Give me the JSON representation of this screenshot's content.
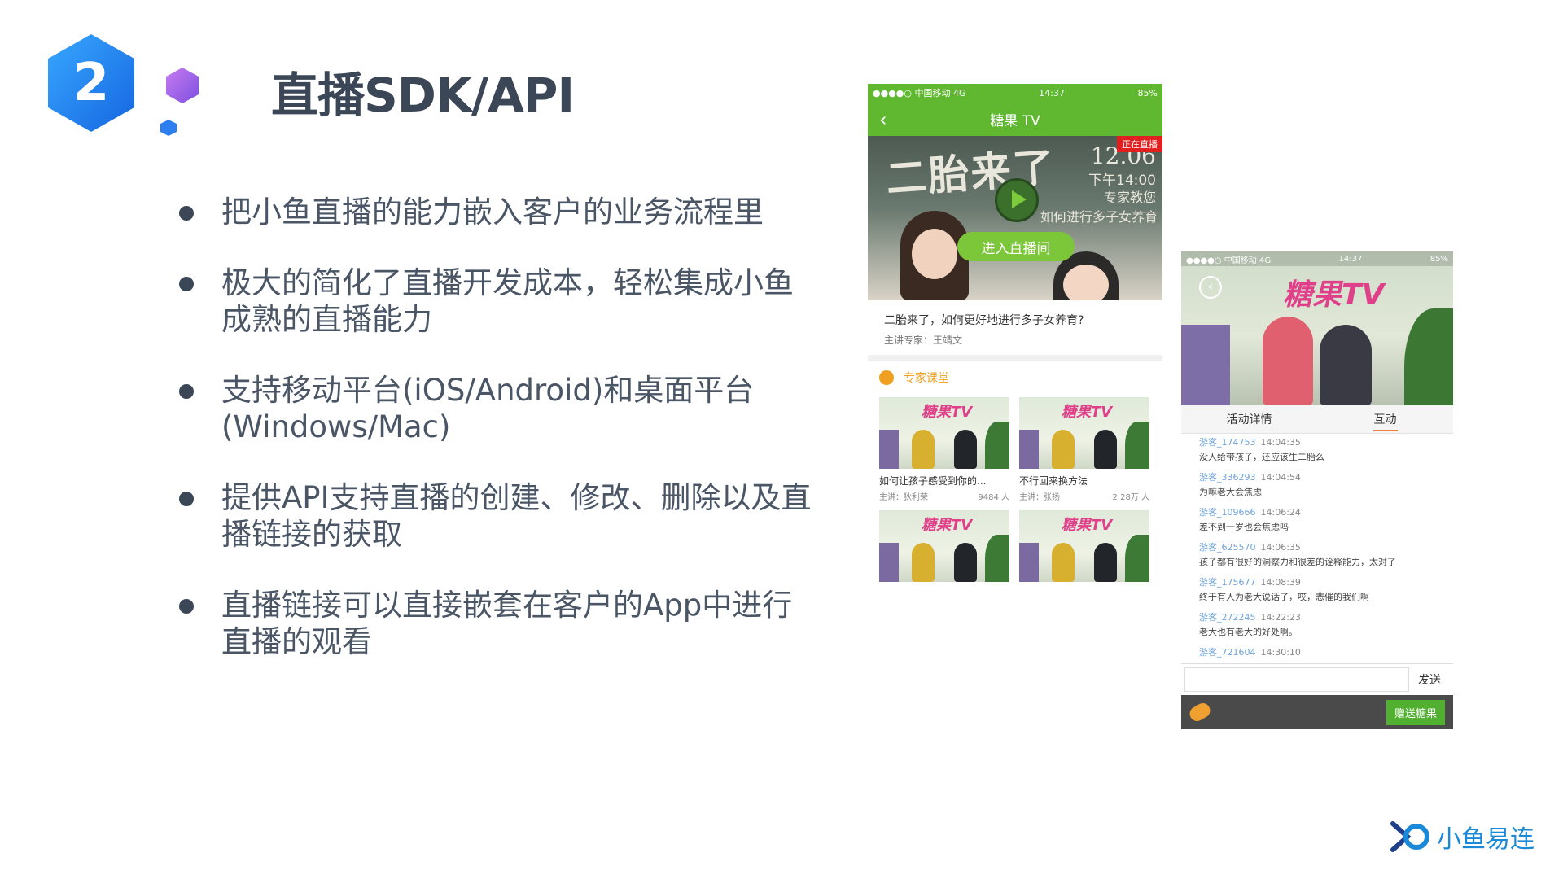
{
  "slide": {
    "number": "2",
    "title": "直播SDK/API",
    "bullets": [
      "把小鱼直播的能力嵌入客户的业务流程里",
      "极大的简化了直播开发成本，轻松集成小鱼成熟的直播能力",
      "支持移动平台(iOS/Android)和桌面平台(Windows/Mac)",
      "提供API支持直播的创建、修改、删除以及直播链接的获取",
      "直播链接可以直接嵌套在客户的App中进行直播的观看"
    ]
  },
  "phone1": {
    "status": {
      "carrier": "●●●●○ 中国移动 4G",
      "time": "14:37",
      "battery": "85%"
    },
    "nav_title": "糖果 TV",
    "hero": {
      "live_badge": "正在直播",
      "headline": "二胎来了",
      "date": "12.06",
      "time": "下午14:00",
      "line1": "专家教您",
      "line2": "如何进行多子女养育",
      "enter_label": "进入直播间"
    },
    "event_title": "二胎来了，如何更好地进行多子女养育?",
    "event_host": "主讲专家：王靖文",
    "section_title": "专家课堂",
    "courses": [
      {
        "title": "如何让孩子感受到你的...",
        "host": "主讲：狄利荣",
        "views": "9484 人"
      },
      {
        "title": "不行回来换方法",
        "host": "主讲：张扬",
        "views": "2.28万 人"
      },
      {
        "title": "",
        "host": "",
        "views": ""
      },
      {
        "title": "",
        "host": "",
        "views": ""
      }
    ],
    "thumb_logo": "糖果TV"
  },
  "phone2": {
    "status": {
      "carrier": "●●●●○ 中国移动 4G",
      "time": "14:37",
      "battery": "85%"
    },
    "video_logo": "糖果TV",
    "tabs": [
      "活动详情",
      "互动"
    ],
    "messages": [
      {
        "user": "游客_174753",
        "time": "14:04:35",
        "text": "没人给带孩子，还应该生二胎么"
      },
      {
        "user": "游客_336293",
        "time": "14:04:54",
        "text": "为嘛老大会焦虑"
      },
      {
        "user": "游客_109666",
        "time": "14:06:24",
        "text": "差不到一岁也会焦虑吗"
      },
      {
        "user": "游客_625570",
        "time": "14:06:35",
        "text": "孩子都有很好的洞察力和很差的诠释能力，太对了"
      },
      {
        "user": "游客_175677",
        "time": "14:08:39",
        "text": "终于有人为老大说话了，哎，悲催的我们啊"
      },
      {
        "user": "游客_272245",
        "time": "14:22:23",
        "text": "老大也有老大的好处啊。"
      },
      {
        "user": "游客_721604",
        "time": "14:30:10",
        "text": ""
      }
    ],
    "send_label": "发送",
    "gift_label": "赠送糖果"
  },
  "brand": {
    "name": "小鱼易连"
  },
  "colors": {
    "accent_blue": "#1a8ad8",
    "app_green": "#5fb82f",
    "text_dark": "#3b4657",
    "hex_purple": "#9b59e0"
  }
}
